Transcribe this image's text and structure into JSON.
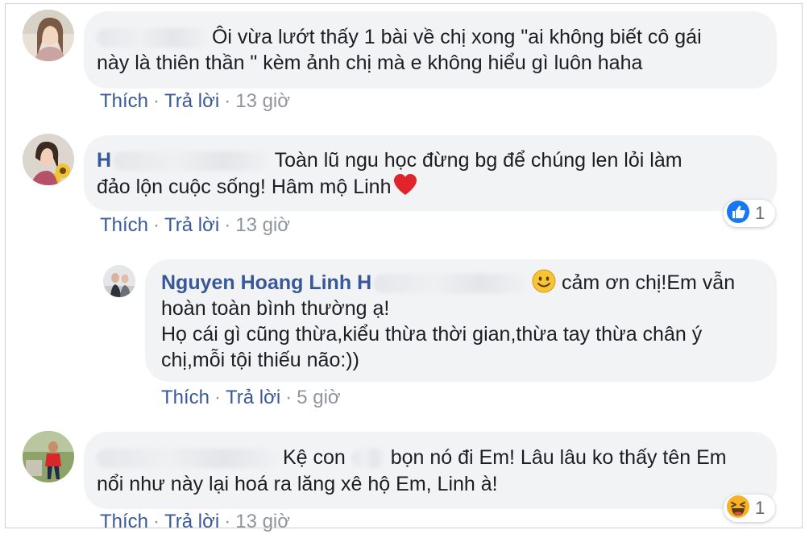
{
  "comments": [
    {
      "text_line1": "Ôi vừa lướt thấy 1 bài về chị xong \"ai không biết cô gái",
      "text_line2": "này là thiên thần \" kèm ảnh chị mà e không hiểu gì luôn haha",
      "like_label": "Thích",
      "reply_label": "Trả lời",
      "time": "13 giờ"
    },
    {
      "name_initial": "H",
      "text_line1": "Toàn lũ ngu học đừng bg để chúng len lỏi làm",
      "text_line2": "đảo lộn cuộc sống! Hâm mộ Linh",
      "emoji": "heart-emoji",
      "like_label": "Thích",
      "reply_label": "Trả lời",
      "time": "13 giờ",
      "reaction": {
        "type": "like",
        "count": "1",
        "color": "#1877f2"
      }
    },
    {
      "name": "Nguyen Hoang Linh",
      "name_initial2": "H",
      "text_line1": "cảm ơn chị!Em vẫn",
      "text_line2": "hoàn toàn bình thường ạ!",
      "text_line3": "Họ cái gì cũng thừa,kiểu thừa thời gian,thừa tay thừa chân ý",
      "text_line4": "chị,mỗi tội thiếu não:))",
      "emoji": "smile-emoji",
      "like_label": "Thích",
      "reply_label": "Trả lời",
      "time": "5 giờ"
    },
    {
      "text_line1a": "Kệ con",
      "text_line1b": "bọn nó đi Em! Lâu lâu ko thấy tên Em",
      "text_line2": "nổi như này lại hoá ra lăng xê hộ Em, Linh à!",
      "like_label": "Thích",
      "reply_label": "Trả lời",
      "time": "13 giờ",
      "reaction": {
        "type": "haha",
        "count": "1",
        "color": "#f7b125"
      }
    }
  ],
  "colors": {
    "link": "#385898",
    "bubble": "#f2f3f5",
    "meta": "#90949c"
  }
}
